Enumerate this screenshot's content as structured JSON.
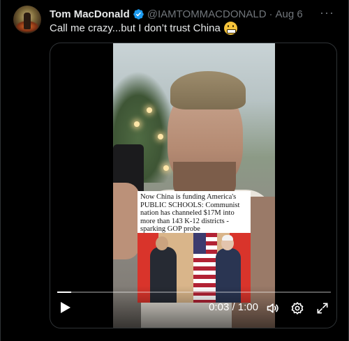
{
  "tweet": {
    "author_name": "Tom MacDonald",
    "handle": "@IAMTOMMACDONALD",
    "separator": "·",
    "timestamp": "Aug 6",
    "more_label": "···",
    "text": "Call me crazy...but I don’t trust China"
  },
  "icons": {
    "verified": "verified-badge-icon",
    "emoji": "grimacing-face-emoji",
    "play": "play-icon",
    "volume": "volume-icon",
    "settings": "gear-icon",
    "expand": "fullscreen-icon"
  },
  "video": {
    "overlay_headline": "Now China is funding America's PUBLIC SCHOOLS: Communist nation has channeled $17M into more than 143 K-12 districts - sparking GOP probe",
    "time_display": "0:03 / 1:00",
    "progress_fraction": 0.05
  },
  "colors": {
    "background": "#000000",
    "text_primary": "#e7e9ea",
    "text_secondary": "#71767b",
    "verified_blue": "#1d9bf0",
    "border": "#2f3336"
  }
}
